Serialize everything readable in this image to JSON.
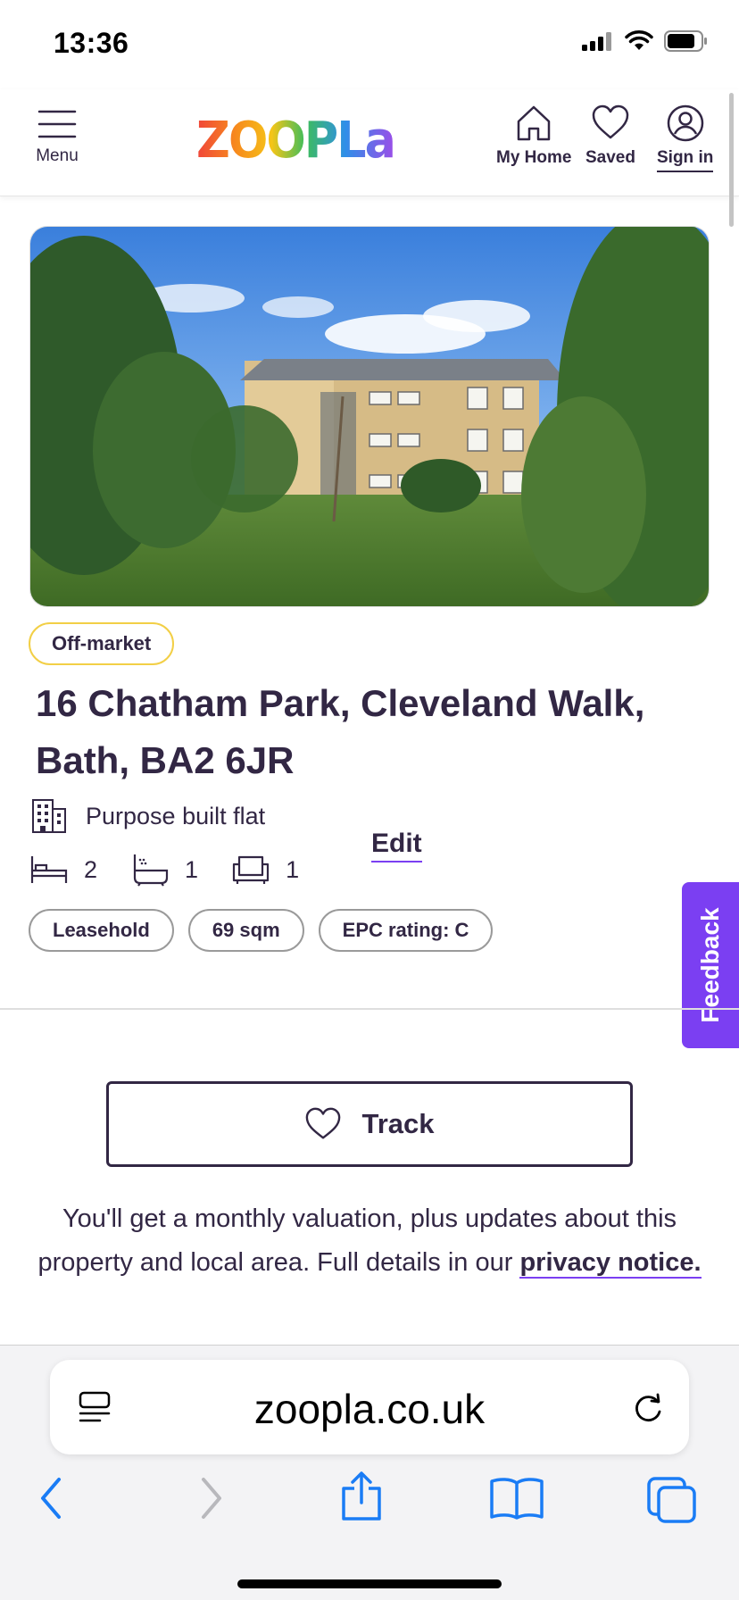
{
  "status_bar": {
    "time": "13:36"
  },
  "header": {
    "menu_label": "Menu",
    "logo_text": "zoopla",
    "nav": [
      {
        "label": "My Home",
        "icon": "home-icon"
      },
      {
        "label": "Saved",
        "icon": "heart-icon"
      },
      {
        "label": "Sign in",
        "icon": "user-icon"
      }
    ]
  },
  "listing": {
    "status_badge": "Off-market",
    "address": "16 Chatham Park, Cleveland Walk, Bath, BA2 6JR",
    "property_type": "Purpose built flat",
    "bedrooms": "2",
    "bathrooms": "1",
    "reception_rooms": "1",
    "edit_label": "Edit",
    "tags": [
      "Leasehold",
      "69 sqm",
      "EPC rating: C"
    ]
  },
  "feedback": {
    "label": "Feedback"
  },
  "track": {
    "button_label": "Track",
    "info_text": "You'll get a monthly valuation, plus updates about this property and local area. Full details in our",
    "privacy_link": "privacy notice."
  },
  "browser": {
    "url": "zoopla.co.uk"
  },
  "colors": {
    "brand_text": "#322744",
    "accent_purple": "#7b3ff2",
    "badge_yellow": "#f2cf46",
    "safari_blue": "#1a7cf5"
  }
}
